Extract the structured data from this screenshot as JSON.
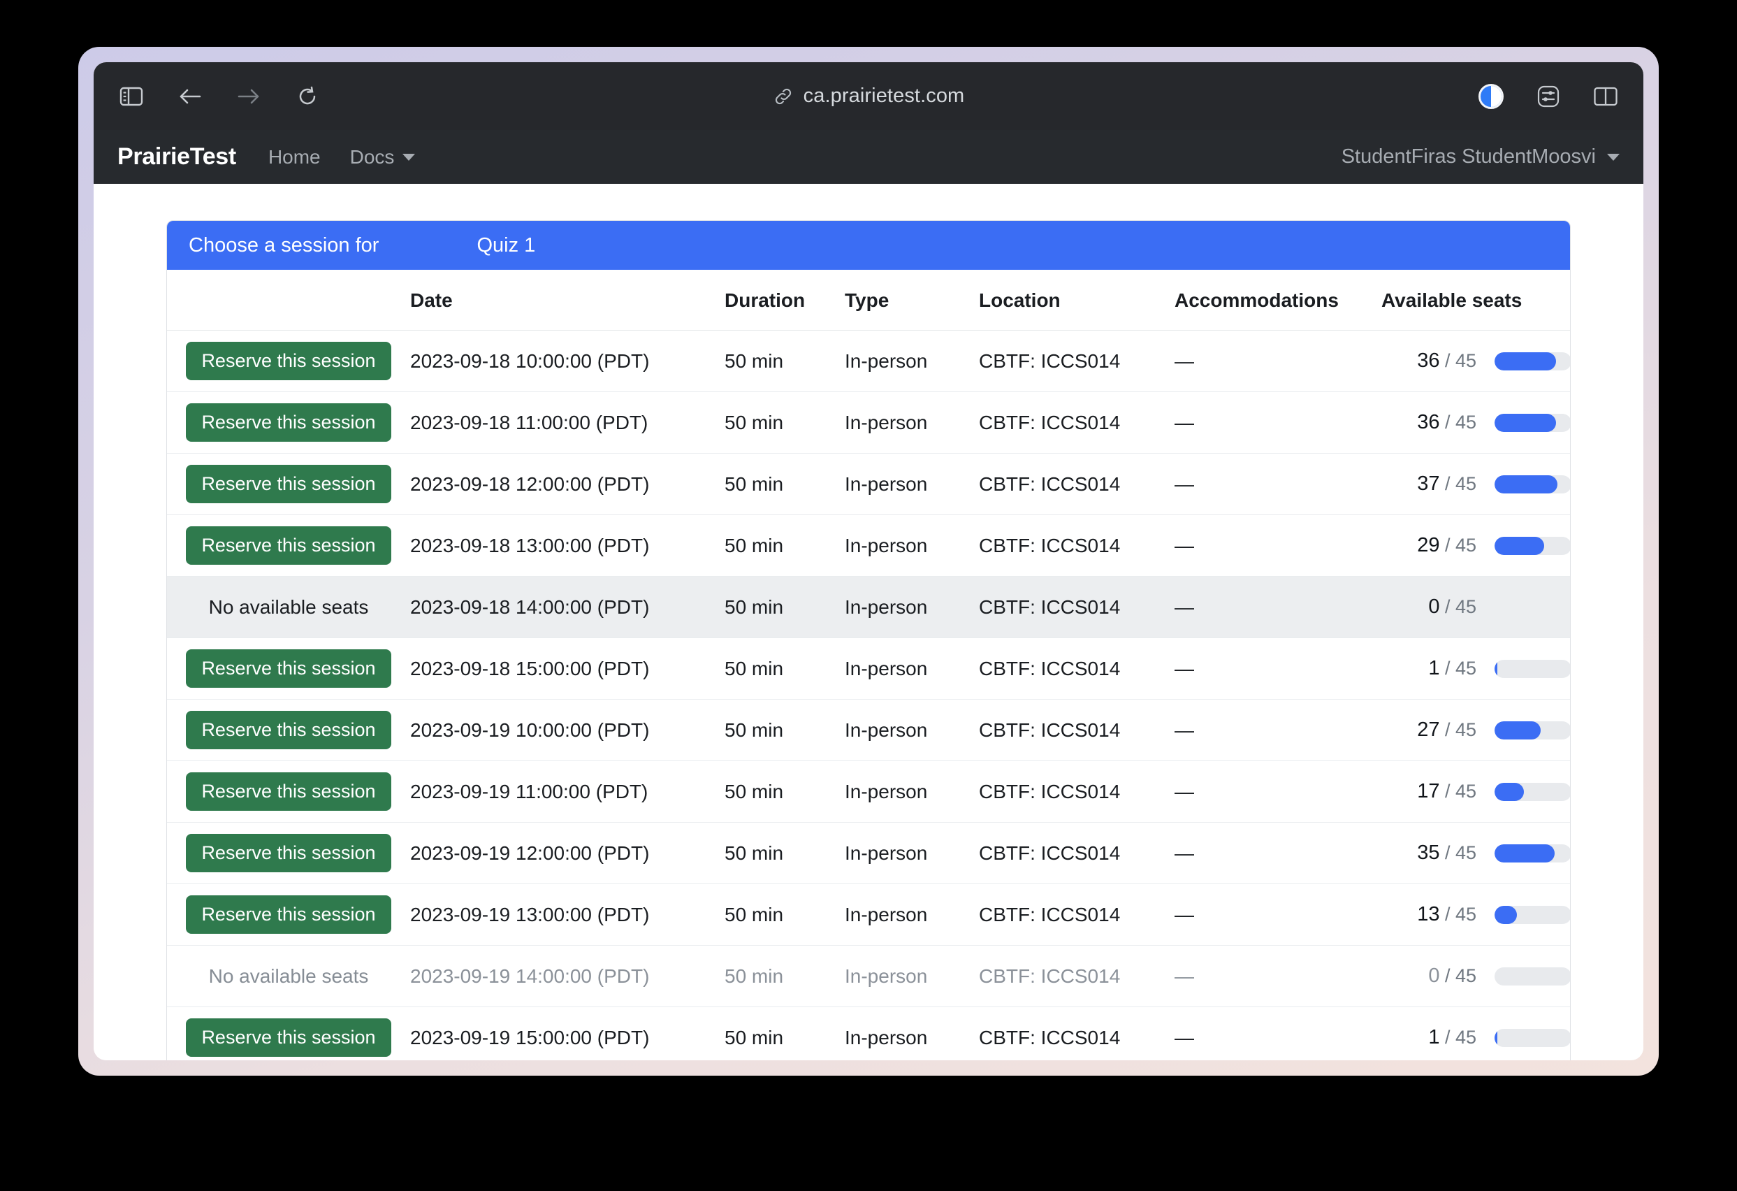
{
  "browser": {
    "url": "ca.prairietest.com",
    "link_icon": "link-icon",
    "sidebar_icon": "sidebar-toggle-icon",
    "back_icon": "back-arrow-icon",
    "forward_icon": "forward-arrow-icon",
    "reload_icon": "reload-icon",
    "password_icon": "1password-icon",
    "extensions_icon": "settings-sliders-icon",
    "tabgroup_icon": "split-view-icon"
  },
  "navbar": {
    "brand": "PrairieTest",
    "links": [
      {
        "label": "Home",
        "caret": false
      },
      {
        "label": "Docs",
        "caret": true
      }
    ],
    "user": "StudentFiras StudentMoosvi"
  },
  "card": {
    "header_prefix": "Choose a session for",
    "header_assessment": "Quiz 1",
    "accent_blue": "#3b6df4",
    "accent_green": "#2f7a4d",
    "columns": [
      "",
      "Date",
      "Duration",
      "Type",
      "Location",
      "Accommodations",
      "Available seats"
    ],
    "reserve_label": "Reserve this session",
    "no_seats_label": "No available seats",
    "seat_separator": "/",
    "seat_capacity": "45",
    "rows": [
      {
        "action": "reserve",
        "date": "2023-09-18 10:00:00 (PDT)",
        "duration": "50 min",
        "type": "In-person",
        "location": "CBTF: ICCS014",
        "accommodations": "—",
        "seats": "36",
        "capacity": "45",
        "state": "normal"
      },
      {
        "action": "reserve",
        "date": "2023-09-18 11:00:00 (PDT)",
        "duration": "50 min",
        "type": "In-person",
        "location": "CBTF: ICCS014",
        "accommodations": "—",
        "seats": "36",
        "capacity": "45",
        "state": "normal"
      },
      {
        "action": "reserve",
        "date": "2023-09-18 12:00:00 (PDT)",
        "duration": "50 min",
        "type": "In-person",
        "location": "CBTF: ICCS014",
        "accommodations": "—",
        "seats": "37",
        "capacity": "45",
        "state": "normal"
      },
      {
        "action": "reserve",
        "date": "2023-09-18 13:00:00 (PDT)",
        "duration": "50 min",
        "type": "In-person",
        "location": "CBTF: ICCS014",
        "accommodations": "—",
        "seats": "29",
        "capacity": "45",
        "state": "normal"
      },
      {
        "action": "none",
        "date": "2023-09-18 14:00:00 (PDT)",
        "duration": "50 min",
        "type": "In-person",
        "location": "CBTF: ICCS014",
        "accommodations": "—",
        "seats": "0",
        "capacity": "45",
        "state": "hovered"
      },
      {
        "action": "reserve",
        "date": "2023-09-18 15:00:00 (PDT)",
        "duration": "50 min",
        "type": "In-person",
        "location": "CBTF: ICCS014",
        "accommodations": "—",
        "seats": "1",
        "capacity": "45",
        "state": "normal"
      },
      {
        "action": "reserve",
        "date": "2023-09-19 10:00:00 (PDT)",
        "duration": "50 min",
        "type": "In-person",
        "location": "CBTF: ICCS014",
        "accommodations": "—",
        "seats": "27",
        "capacity": "45",
        "state": "normal"
      },
      {
        "action": "reserve",
        "date": "2023-09-19 11:00:00 (PDT)",
        "duration": "50 min",
        "type": "In-person",
        "location": "CBTF: ICCS014",
        "accommodations": "—",
        "seats": "17",
        "capacity": "45",
        "state": "normal"
      },
      {
        "action": "reserve",
        "date": "2023-09-19 12:00:00 (PDT)",
        "duration": "50 min",
        "type": "In-person",
        "location": "CBTF: ICCS014",
        "accommodations": "—",
        "seats": "35",
        "capacity": "45",
        "state": "normal"
      },
      {
        "action": "reserve",
        "date": "2023-09-19 13:00:00 (PDT)",
        "duration": "50 min",
        "type": "In-person",
        "location": "CBTF: ICCS014",
        "accommodations": "—",
        "seats": "13",
        "capacity": "45",
        "state": "normal"
      },
      {
        "action": "none",
        "date": "2023-09-19 14:00:00 (PDT)",
        "duration": "50 min",
        "type": "In-person",
        "location": "CBTF: ICCS014",
        "accommodations": "—",
        "seats": "0",
        "capacity": "45",
        "state": "disabled"
      },
      {
        "action": "reserve",
        "date": "2023-09-19 15:00:00 (PDT)",
        "duration": "50 min",
        "type": "In-person",
        "location": "CBTF: ICCS014",
        "accommodations": "—",
        "seats": "1",
        "capacity": "45",
        "state": "normal"
      }
    ]
  }
}
